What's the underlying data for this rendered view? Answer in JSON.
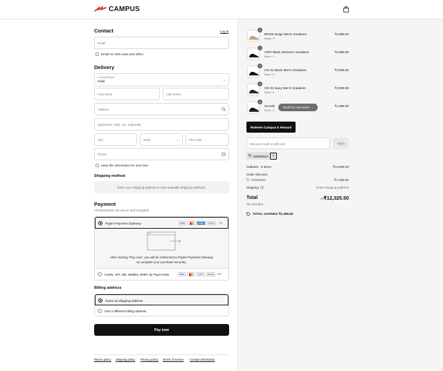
{
  "brand": {
    "name": "CAMPUS"
  },
  "contact": {
    "title": "Contact",
    "login_label": "Log in",
    "email_placeholder": "Email",
    "email_news_label": "Email me with news and offers"
  },
  "delivery": {
    "title": "Delivery",
    "country_label": "Country/Region",
    "country_value": "India",
    "first_name_placeholder": "First name",
    "last_name_placeholder": "Last name",
    "address_placeholder": "Address",
    "apartment_placeholder": "Apartment, suite, etc. (optional)",
    "city_placeholder": "City",
    "state_placeholder": "State",
    "pin_placeholder": "PIN code",
    "phone_placeholder": "Phone",
    "save_info_label": "Save this information for next time"
  },
  "shipping_method": {
    "title": "Shipping method",
    "message": "Enter your shipping address to view available shipping methods."
  },
  "payment": {
    "title": "Payment",
    "subtitle": "All transactions are secure and encrypted.",
    "option1_label": "Paytm Payment Gateway",
    "option1_extra": "+3",
    "redirect_text": "After clicking “Pay now”, you will be redirected to Paytm Payment Gateway to complete your purchase securely.",
    "option2_label": "Cards, UPI, NB, Wallets, BNPL by PayU India",
    "option2_extra": "+10",
    "card_brands": [
      "VISA",
      "MC",
      "AMEX",
      "RuPay"
    ]
  },
  "billing": {
    "title": "Billing address",
    "option1_label": "Same as shipping address",
    "option2_label": "Use a different billing address"
  },
  "pay_now_label": "Pay now",
  "footer_links": [
    "Return policy",
    "Shipping policy",
    "Privacy policy",
    "Terms of service",
    "Contact information"
  ],
  "cart": {
    "items": [
      {
        "name": "BRISK Beige Men's Sneakers",
        "variant": "Beige / 6",
        "price": "₹2,699.00",
        "qty": "1"
      },
      {
        "name": "GRIT Black Women's Sneakers",
        "variant": "Black / 4",
        "price": "₹2,599.00",
        "qty": "1"
      },
      {
        "name": "OG-41 Black Men's Sneakers",
        "variant": "Black / 6",
        "price": "₹3,099.00",
        "qty": "1"
      },
      {
        "name": "OG-41 Navy Men's Sneakers",
        "variant": "Navy / 6",
        "price": "₹3,099.00",
        "qty": "1"
      },
      {
        "name": "SUAVE",
        "variant": "Black / 4",
        "price": "₹1,999.00",
        "qty": "1"
      }
    ],
    "scroll_hint": "Scroll for more items"
  },
  "redeem_label": "Redeem Campus E Reward",
  "discount": {
    "placeholder": "Discount code or gift card",
    "apply_label": "Apply",
    "applied_code": "WOMEN10"
  },
  "summary": {
    "subtotal_label": "Subtotal · 5 items",
    "subtotal_value": "₹13,695.00",
    "order_discount_label": "Order discount",
    "discount_code": "WOMEN10",
    "discount_value": "−₹1,369.50",
    "shipping_label": "Shipping",
    "shipping_value": "Enter shipping address",
    "total_label": "Total",
    "currency": "INR",
    "total_value": "₹12,325.50",
    "tax_note": "Tax included",
    "savings_label": "TOTAL SAVINGS ₹1,369.50"
  },
  "colors": {
    "primary": "#111111",
    "brand_accent": "#e3262c",
    "sidebar_bg": "#f5f5f5"
  }
}
